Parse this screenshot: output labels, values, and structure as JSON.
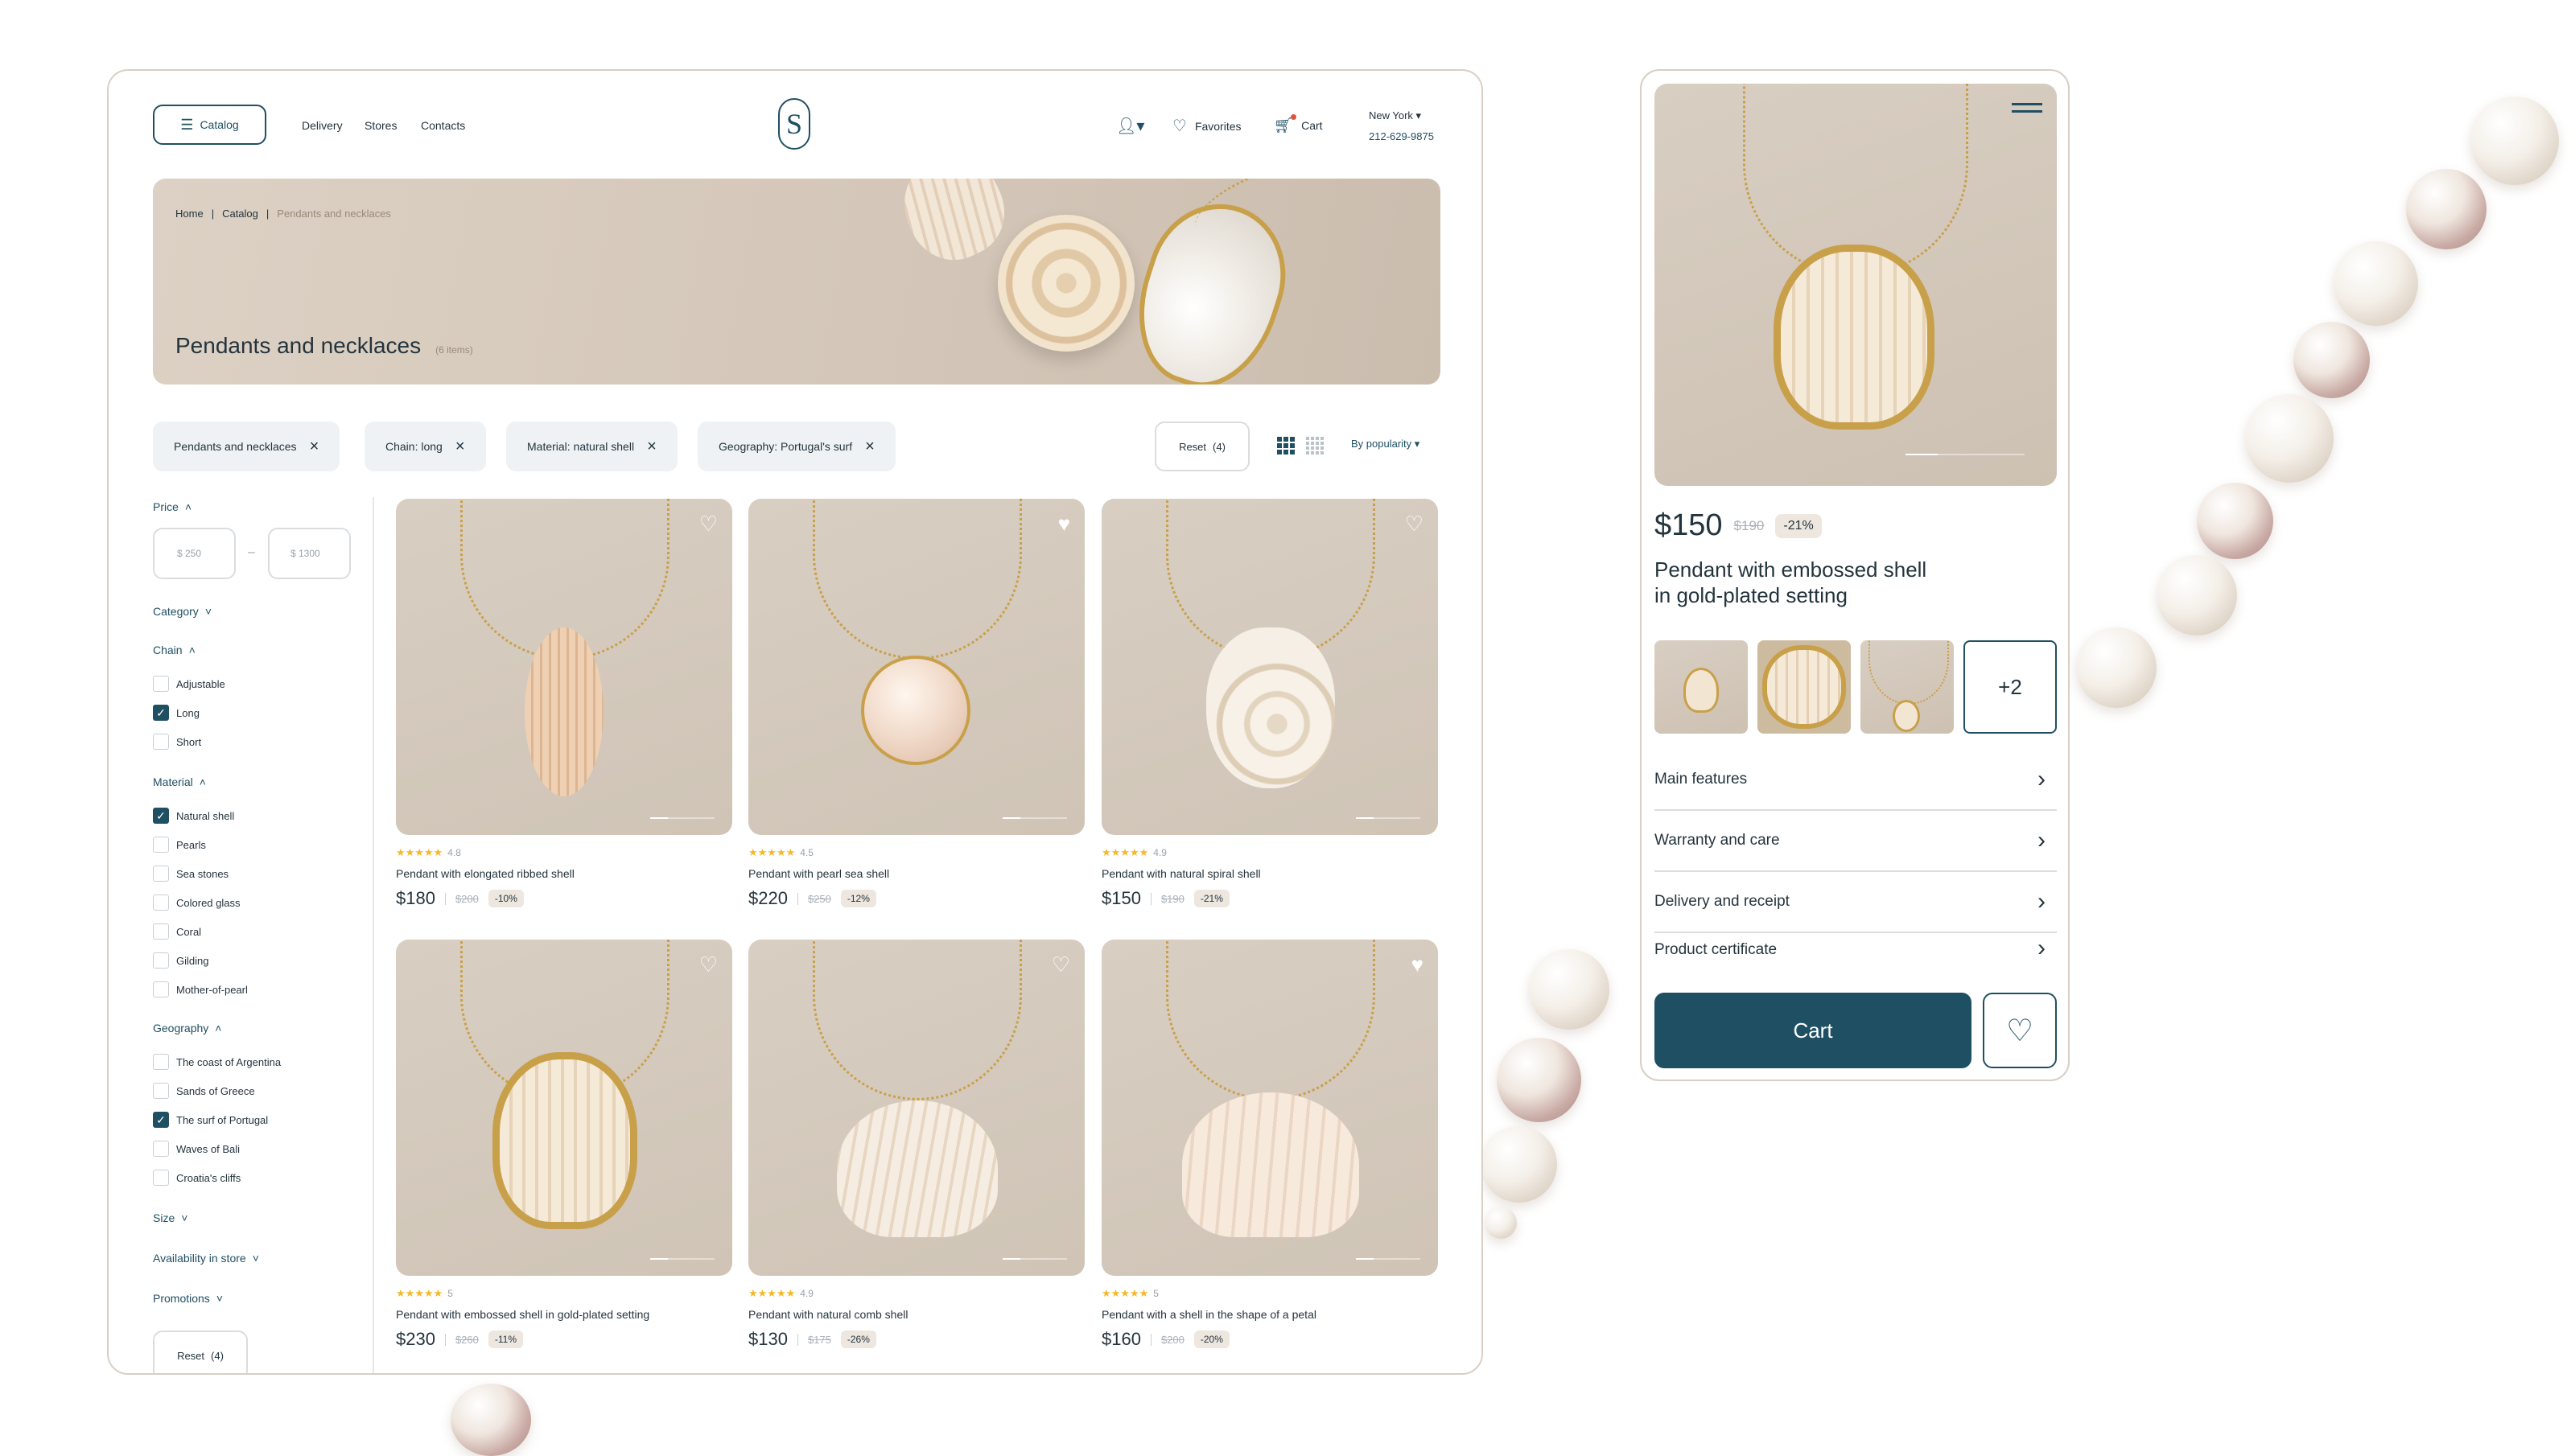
{
  "header": {
    "catalog": "Catalog",
    "nav": [
      "Delivery",
      "Stores",
      "Contacts"
    ],
    "favorites": "Favorites",
    "cart": "Cart",
    "city": "New York",
    "phone": "212-629-9875",
    "logo": "S"
  },
  "breadcrumb": {
    "home": "Home",
    "catalog": "Catalog",
    "current": "Pendants and necklaces"
  },
  "page": {
    "title": "Pendants and necklaces",
    "count": "(6 items)"
  },
  "filters": {
    "chips": [
      "Pendants and necklaces",
      "Chain: long",
      "Material: natural shell",
      "Geography: Portugal's surf"
    ],
    "reset": "Reset",
    "reset_count": "(4)",
    "sort": "By popularity"
  },
  "sidebar": {
    "price": {
      "label": "Price",
      "from": "$ 250",
      "to": "$ 1300"
    },
    "category": "Category",
    "chain": {
      "label": "Chain",
      "items": [
        {
          "label": "Adjustable",
          "checked": false
        },
        {
          "label": "Long",
          "checked": true
        },
        {
          "label": "Short",
          "checked": false
        }
      ]
    },
    "material": {
      "label": "Material",
      "items": [
        {
          "label": "Natural shell",
          "checked": true
        },
        {
          "label": "Pearls",
          "checked": false
        },
        {
          "label": "Sea stones",
          "checked": false
        },
        {
          "label": "Colored glass",
          "checked": false
        },
        {
          "label": "Coral",
          "checked": false
        },
        {
          "label": "Gilding",
          "checked": false
        },
        {
          "label": "Mother-of-pearl",
          "checked": false
        }
      ]
    },
    "geography": {
      "label": "Geography",
      "items": [
        {
          "label": "The coast of Argentina",
          "checked": false
        },
        {
          "label": "Sands of Greece",
          "checked": false
        },
        {
          "label": "The surf of Portugal",
          "checked": true
        },
        {
          "label": "Waves of Bali",
          "checked": false
        },
        {
          "label": "Croatia's cliffs",
          "checked": false
        }
      ]
    },
    "size": "Size",
    "availability": "Availability in store",
    "promotions": "Promotions",
    "reset": "Reset",
    "reset_count": "(4)"
  },
  "products": [
    {
      "rating": "4.8",
      "name": "Pendant with elongated ribbed shell",
      "price": "$180",
      "old": "$200",
      "discount": "-10%",
      "fav": false
    },
    {
      "rating": "4.5",
      "name": "Pendant with pearl sea shell",
      "price": "$220",
      "old": "$250",
      "discount": "-12%",
      "fav": true
    },
    {
      "rating": "4.9",
      "name": "Pendant with natural spiral shell",
      "price": "$150",
      "old": "$190",
      "discount": "-21%",
      "fav": false
    },
    {
      "rating": "5",
      "name": "Pendant with embossed shell in gold-plated setting",
      "price": "$230",
      "old": "$260",
      "discount": "-11%",
      "fav": false
    },
    {
      "rating": "4.9",
      "name": "Pendant with natural comb shell",
      "price": "$130",
      "old": "$175",
      "discount": "-26%",
      "fav": false
    },
    {
      "rating": "5",
      "name": "Pendant with a shell in the shape of a petal",
      "price": "$160",
      "old": "$200",
      "discount": "-20%",
      "fav": true
    }
  ],
  "stars": "★★★★★",
  "mobile": {
    "price": "$150",
    "old": "$190",
    "discount": "-21%",
    "title_line1": "Pendant with embossed shell",
    "title_line2": "in gold-plated setting",
    "more_photos": "+2",
    "sections": [
      "Main features",
      "Warranty and care",
      "Delivery and receipt",
      "Product certificate"
    ],
    "cart": "Cart"
  },
  "colors": {
    "accent": "#1f4f62",
    "chip_bg": "#eef2f5",
    "gold": "#c9a04a",
    "beige": "#d8cec2"
  }
}
